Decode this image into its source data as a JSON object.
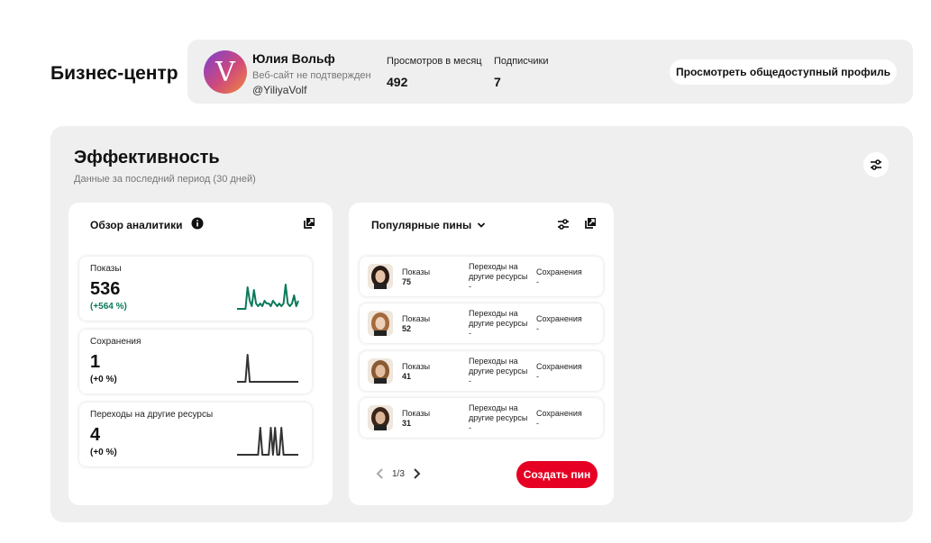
{
  "page": {
    "title": "Бизнес-центр"
  },
  "profile": {
    "avatar_letter": "V",
    "name": "Юлия Вольф",
    "site_status": "Веб-сайт не подтвержден",
    "handle": "@YiliyaVolf",
    "stats": [
      {
        "label": "Просмотров в месяц",
        "value": "492"
      },
      {
        "label": "Подписчики",
        "value": "7"
      }
    ],
    "public_profile_button": "Просмотреть общедоступный профиль"
  },
  "performance": {
    "title": "Эффективность",
    "subtitle": "Данные за последний период (30 дней)",
    "filter_icon": "sliders-icon"
  },
  "analytics": {
    "title": "Обзор аналитики",
    "info_icon": "info-icon",
    "open_icon": "external-link-icon",
    "metrics": [
      {
        "label": "Показы",
        "value": "536",
        "change": "(+564 %)",
        "change_color": "#0b7a5a",
        "spark_color": "#0b7a5a",
        "spark": [
          0,
          0,
          0,
          0,
          0,
          0.8,
          0.3,
          0.1,
          0.7,
          0.2,
          0.1,
          0.2,
          0.1,
          0.3,
          0.2,
          0.2,
          0.1,
          0.3,
          0.2,
          0.1,
          0.2,
          0.1,
          0.2,
          0.9,
          0.2,
          0.1,
          0.2,
          0.5,
          0.1,
          0.3
        ]
      },
      {
        "label": "Сохранения",
        "value": "1",
        "change": "(+0 %)",
        "change_color": "#111111",
        "spark_color": "#333333",
        "spark": [
          0,
          0,
          0,
          0,
          0,
          1,
          0,
          0,
          0,
          0,
          0,
          0,
          0,
          0,
          0,
          0,
          0,
          0,
          0,
          0,
          0,
          0,
          0,
          0,
          0,
          0,
          0,
          0,
          0,
          0
        ]
      },
      {
        "label": "Переходы на другие ресурсы",
        "value": "4",
        "change": "(+0 %)",
        "change_color": "#111111",
        "spark_color": "#333333",
        "spark": [
          0,
          0,
          0,
          0,
          0,
          0,
          0,
          0,
          0,
          0,
          0,
          1,
          0,
          0,
          0,
          0,
          1,
          0,
          1,
          0,
          0,
          1,
          0,
          0,
          0,
          0,
          0,
          0,
          0,
          0
        ]
      }
    ]
  },
  "popular_pins": {
    "title": "Популярные пины",
    "dropdown_icon": "chevron-down-icon",
    "filter_icon": "sliders-icon",
    "open_icon": "external-link-icon",
    "columns": {
      "impressions": "Показы",
      "outbound": "Переходы на другие ресурсы",
      "saves": "Сохранения"
    },
    "rows": [
      {
        "impressions": "75",
        "outbound": "-",
        "saves": "-",
        "hair": "#2a1a14",
        "skin": "#e6c3a6"
      },
      {
        "impressions": "52",
        "outbound": "-",
        "saves": "-",
        "hair": "#a56a3c",
        "skin": "#ecd0b8"
      },
      {
        "impressions": "41",
        "outbound": "-",
        "saves": "-",
        "hair": "#8a5a30",
        "skin": "#e3bea0"
      },
      {
        "impressions": "31",
        "outbound": "-",
        "saves": "-",
        "hair": "#3a2418",
        "skin": "#dcb598"
      }
    ],
    "pagination": "1/3",
    "create_button": "Создать пин",
    "create_color": "#e60023"
  }
}
